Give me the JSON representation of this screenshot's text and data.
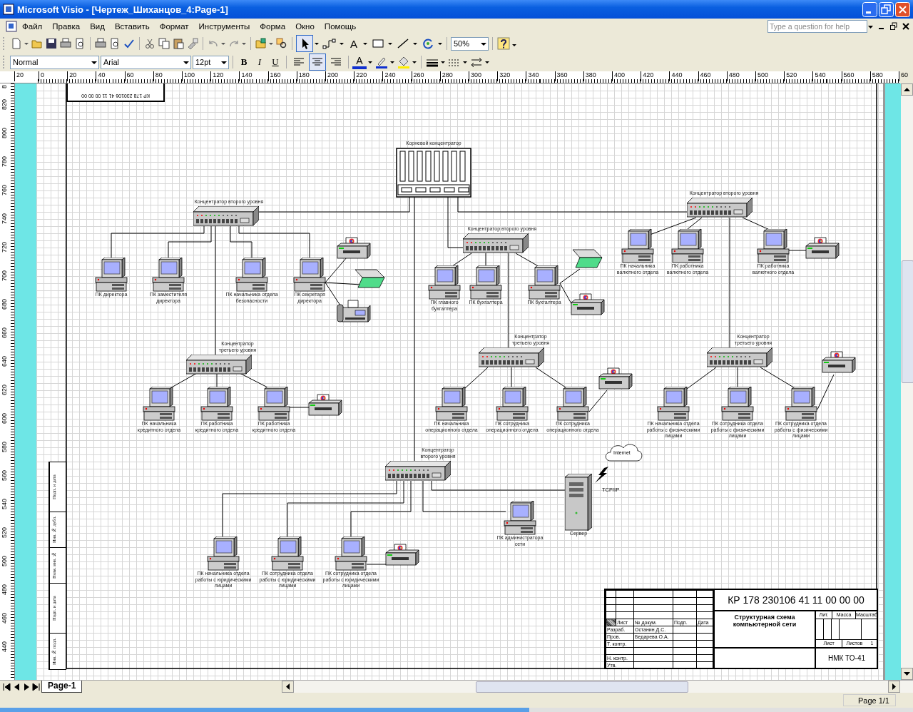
{
  "window": {
    "title": "Microsoft Visio - [Чертеж_Шиханцов_4:Page-1]"
  },
  "menu": [
    "Файл",
    "Правка",
    "Вид",
    "Вставить",
    "Формат",
    "Инструменты",
    "Форма",
    "Окно",
    "Помощь"
  ],
  "help_box": {
    "placeholder": "Type a question for help"
  },
  "standard_toolbar": {
    "zoom": "50%",
    "tools": [
      {
        "kind": "pointer",
        "selected": true
      },
      {
        "kind": "connector",
        "selected": false
      },
      {
        "kind": "text",
        "label": "A",
        "selected": false
      },
      {
        "kind": "rectangle",
        "selected": false
      },
      {
        "kind": "line",
        "selected": false
      },
      {
        "kind": "rotate",
        "selected": false
      }
    ]
  },
  "format_toolbar": {
    "style": "Normal",
    "font": "Arial",
    "size": "12pt",
    "font_color_label": "A",
    "styles": [
      {
        "kind": "bold",
        "label": "B"
      },
      {
        "kind": "italic",
        "label": "I"
      },
      {
        "kind": "underline",
        "label": "U"
      }
    ],
    "alignment": [
      {
        "kind": "left",
        "selected": false
      },
      {
        "kind": "center",
        "selected": true
      },
      {
        "kind": "right",
        "selected": false
      }
    ]
  },
  "hruler": [
    "20",
    "0",
    "20",
    "40",
    "60",
    "80",
    "100",
    "120",
    "140",
    "160",
    "180",
    "200",
    "220",
    "240",
    "260",
    "280",
    "300",
    "320",
    "340",
    "360",
    "380",
    "400",
    "420",
    "440",
    "460",
    "480",
    "500",
    "520",
    "540",
    "560",
    "580",
    "60"
  ],
  "vruler": [
    "8",
    "820",
    "800",
    "780",
    "760",
    "740",
    "720",
    "700",
    "680",
    "660",
    "640",
    "620",
    "600",
    "580",
    "560",
    "540",
    "520",
    "500",
    "480",
    "460",
    "440"
  ],
  "drawing": {
    "stamp": "КР 178 230106 41 11 00 00 00",
    "side_stamp": [
      "Подп. и дата",
      "Инв. № дубл.",
      "Взам. инв. №",
      "Подп. и дата",
      "Инв. № подл."
    ],
    "nodes": [
      {
        "kind": "root_hub",
        "label": "Корневой концентратор"
      },
      {
        "kind": "hub",
        "label": "Концентратор второго уровня"
      },
      {
        "kind": "hub",
        "label": "Концентратор второго уровня"
      },
      {
        "kind": "hub",
        "label": "Концентратор второго уровня"
      },
      {
        "kind": "hub",
        "label": "Концентратор третьего уровня"
      },
      {
        "kind": "hub",
        "label": "Концентратор третьего уровня"
      },
      {
        "kind": "hub",
        "label": "Концентратор третьего уровня"
      },
      {
        "kind": "hub",
        "label": "Концентратор второго уровня"
      },
      {
        "kind": "pc",
        "label": "ПК директора"
      },
      {
        "kind": "pc",
        "label": "ПК заместителя директора"
      },
      {
        "kind": "pc",
        "label": "ПК начальника отдела безопасности"
      },
      {
        "kind": "pc",
        "label": "ПК секретаря директора"
      },
      {
        "kind": "pc",
        "label": "ПК главного бухгалтера"
      },
      {
        "kind": "pc",
        "label": "ПК бухгалтера"
      },
      {
        "kind": "pc",
        "label": "ПК бухгалтера"
      },
      {
        "kind": "pc",
        "label": "ПК начальника валютного отдела"
      },
      {
        "kind": "pc",
        "label": "ПК работника валютного отдела"
      },
      {
        "kind": "pc",
        "label": "ПК работника валютного отдела"
      },
      {
        "kind": "pc",
        "label": "ПК начальника кредитного отдела"
      },
      {
        "kind": "pc",
        "label": "ПК работника кредитного отдела"
      },
      {
        "kind": "pc",
        "label": "ПК работника кредитного отдела"
      },
      {
        "kind": "pc",
        "label": "ПК начальника операционного отдела"
      },
      {
        "kind": "pc",
        "label": "ПК сотрудника операционного отдела"
      },
      {
        "kind": "pc",
        "label": "ПК сотрудника операционного отдела"
      },
      {
        "kind": "pc",
        "label": "ПК начальника отдела работы с физическими лицами"
      },
      {
        "kind": "pc",
        "label": "ПК сотрудника отдела работы с физическими лицами"
      },
      {
        "kind": "pc",
        "label": "ПК сотрудника отдела работы с физическими лицами"
      },
      {
        "kind": "pc",
        "label": "ПК начальника отдела работы с юридическими лицами"
      },
      {
        "kind": "pc",
        "label": "ПК сотрудника отдела работы с юридическими лицами"
      },
      {
        "kind": "pc",
        "label": "ПК сотрудника отдела работы с юридическими лицами"
      },
      {
        "kind": "pc",
        "label": "ПК администратора сети"
      },
      {
        "kind": "server",
        "label": "Сервер"
      },
      {
        "kind": "cloud",
        "label": "Internet"
      },
      {
        "kind": "printer"
      },
      {
        "kind": "printer"
      },
      {
        "kind": "printer"
      },
      {
        "kind": "printer"
      },
      {
        "kind": "printer"
      },
      {
        "kind": "printer"
      },
      {
        "kind": "printer"
      },
      {
        "kind": "scanner"
      },
      {
        "kind": "scanner"
      },
      {
        "kind": "fax"
      },
      {
        "kind": "text",
        "label": "TCP/IP"
      }
    ],
    "title_block": {
      "code": "КР 178 230106 41 11 00 00 00",
      "title": "Структурная схема компьютерной сети",
      "header": [
        "Лист",
        "№ докум.",
        "Подп.",
        "Дата"
      ],
      "signatures": [
        {
          "role": "Разраб.",
          "name": "Останин Д.С."
        },
        {
          "role": "Пров.",
          "name": "Бедарева О.А."
        },
        {
          "role": "Т. контр."
        },
        {
          "role": "Н. контр."
        },
        {
          "role": "Утв."
        }
      ],
      "letter_header": [
        "Лит.",
        "Масса",
        "Масштаб"
      ],
      "sheet_label": "Лист",
      "sheets_label": "Листов",
      "sheets_count": "1",
      "organization": "НМК ТО-41"
    }
  },
  "page_tabs": [
    {
      "label": "Page-1",
      "selected": true
    }
  ],
  "status_bar": {
    "page": "Page 1/1"
  }
}
